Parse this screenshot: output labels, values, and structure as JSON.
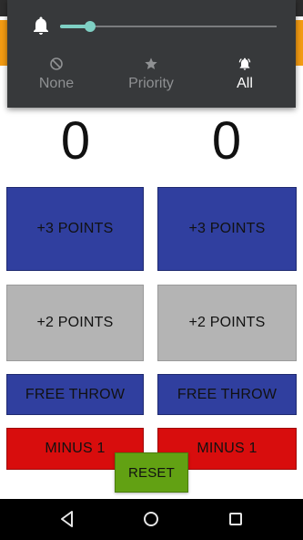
{
  "volume_panel": {
    "icon": "bell-icon",
    "slider_level": 0.14,
    "accent_color": "#7fd0c4",
    "modes": [
      {
        "label": "None",
        "icon": "do-not-disturb-icon",
        "active": false
      },
      {
        "label": "Priority",
        "icon": "star-icon",
        "active": false
      },
      {
        "label": "All",
        "icon": "bell-ringing-icon",
        "active": true
      }
    ]
  },
  "scores": {
    "team_a": "0",
    "team_b": "0"
  },
  "buttons": {
    "plus3": "+3 POINTS",
    "plus2": "+2 POINTS",
    "free_throw": "FREE THROW",
    "minus1": "MINUS 1",
    "reset": "RESET"
  },
  "colors": {
    "plus3": "#303f9f",
    "plus2": "#b4b4b4",
    "free_throw": "#303f9f",
    "minus1": "#d80d0d",
    "reset": "#62a113",
    "header": "#f39b12"
  },
  "nav": {
    "back": "back-icon",
    "home": "home-icon",
    "recents": "recents-icon"
  }
}
